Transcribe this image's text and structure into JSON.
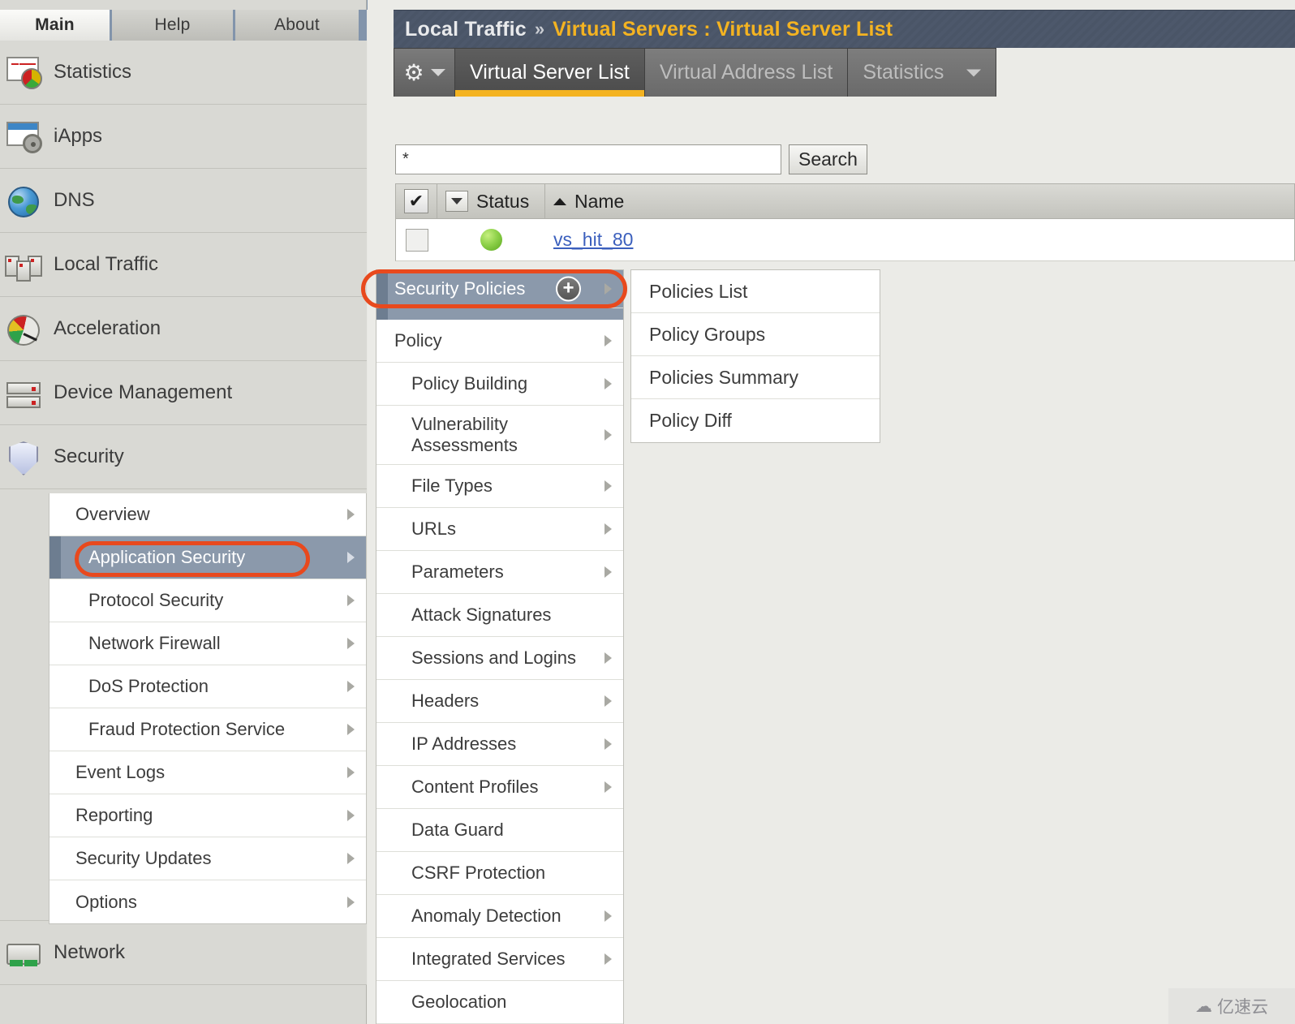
{
  "nav_tabs": [
    {
      "label": "Main",
      "active": true
    },
    {
      "label": "Help",
      "active": false
    },
    {
      "label": "About",
      "active": false
    }
  ],
  "sidebar": {
    "items": [
      {
        "label": "Statistics",
        "icon": "statistics-chart-icon"
      },
      {
        "label": "iApps",
        "icon": "iapps-window-gear-icon"
      },
      {
        "label": "DNS",
        "icon": "globe-icon"
      },
      {
        "label": "Local Traffic",
        "icon": "servers-icon"
      },
      {
        "label": "Acceleration",
        "icon": "speedometer-icon"
      },
      {
        "label": "Device Management",
        "icon": "device-rack-icon"
      },
      {
        "label": "Security",
        "icon": "shield-icon"
      },
      {
        "label": "Network",
        "icon": "network-switch-icon"
      }
    ],
    "security_submenu": [
      {
        "label": "Overview",
        "has_arrow": true,
        "selected": false,
        "indent": 1
      },
      {
        "label": "Application Security",
        "has_arrow": true,
        "selected": true,
        "indent": 2
      },
      {
        "label": "Protocol Security",
        "has_arrow": true,
        "selected": false,
        "indent": 2
      },
      {
        "label": "Network Firewall",
        "has_arrow": true,
        "selected": false,
        "indent": 2
      },
      {
        "label": "DoS Protection",
        "has_arrow": true,
        "selected": false,
        "indent": 2
      },
      {
        "label": "Fraud Protection Service",
        "has_arrow": true,
        "selected": false,
        "indent": 2
      },
      {
        "label": "Event Logs",
        "has_arrow": true,
        "selected": false,
        "indent": 1
      },
      {
        "label": "Reporting",
        "has_arrow": true,
        "selected": false,
        "indent": 1
      },
      {
        "label": "Security Updates",
        "has_arrow": true,
        "selected": false,
        "indent": 1
      },
      {
        "label": "Options",
        "has_arrow": true,
        "selected": false,
        "indent": 1
      }
    ]
  },
  "breadcrumb": {
    "module": "Local Traffic",
    "separator": "»",
    "page": "Virtual Servers : Virtual Server List"
  },
  "tabs": {
    "gear_icon": "gear-icon",
    "items": [
      {
        "label": "Virtual Server List",
        "active": true,
        "has_caret": false
      },
      {
        "label": "Virtual Address List",
        "active": false,
        "has_caret": false
      },
      {
        "label": "Statistics",
        "active": false,
        "has_caret": true
      }
    ]
  },
  "search": {
    "value": "*",
    "placeholder": "",
    "button_label": "Search"
  },
  "table": {
    "headers": {
      "check": "select-all",
      "status": "Status",
      "name": "Name"
    },
    "rows": [
      {
        "checked": false,
        "status": "available-green",
        "name": "vs_hit_80"
      }
    ]
  },
  "flyout": {
    "items": [
      {
        "label": "Security Policies",
        "selected": true,
        "has_arrow": true,
        "has_plus": true,
        "plus_label": "+"
      },
      {
        "label": "Policy",
        "selected": false,
        "has_arrow": true,
        "has_plus": false
      },
      {
        "label": "Policy Building",
        "selected": false,
        "has_arrow": true,
        "has_plus": false
      },
      {
        "label": "Vulnerability Assessments",
        "selected": false,
        "has_arrow": true,
        "has_plus": false,
        "two_line": true
      },
      {
        "label": "File Types",
        "selected": false,
        "has_arrow": true,
        "has_plus": false
      },
      {
        "label": "URLs",
        "selected": false,
        "has_arrow": true,
        "has_plus": false
      },
      {
        "label": "Parameters",
        "selected": false,
        "has_arrow": true,
        "has_plus": false
      },
      {
        "label": "Attack Signatures",
        "selected": false,
        "has_arrow": false,
        "has_plus": false
      },
      {
        "label": "Sessions and Logins",
        "selected": false,
        "has_arrow": true,
        "has_plus": false
      },
      {
        "label": "Headers",
        "selected": false,
        "has_arrow": true,
        "has_plus": false
      },
      {
        "label": "IP Addresses",
        "selected": false,
        "has_arrow": true,
        "has_plus": false
      },
      {
        "label": "Content Profiles",
        "selected": false,
        "has_arrow": true,
        "has_plus": false
      },
      {
        "label": "Data Guard",
        "selected": false,
        "has_arrow": false,
        "has_plus": false
      },
      {
        "label": "CSRF Protection",
        "selected": false,
        "has_arrow": false,
        "has_plus": false
      },
      {
        "label": "Anomaly Detection",
        "selected": false,
        "has_arrow": true,
        "has_plus": false
      },
      {
        "label": "Integrated Services",
        "selected": false,
        "has_arrow": true,
        "has_plus": false
      },
      {
        "label": "Geolocation",
        "selected": false,
        "has_arrow": false,
        "has_plus": false
      }
    ]
  },
  "submenu": {
    "items": [
      {
        "label": "Policies List"
      },
      {
        "label": "Policy Groups"
      },
      {
        "label": "Policies Summary"
      },
      {
        "label": "Policy Diff"
      }
    ]
  },
  "watermark": {
    "icon": "cloud-icon",
    "text": "亿速云"
  },
  "colors": {
    "accent_yellow": "#f4b321",
    "highlight_orange": "#e8491d",
    "selected_slate": "#8b99ab",
    "breadcrumb_bg": "#4d586b",
    "status_green": "#8ed14a",
    "link_blue": "#3b5fbd"
  }
}
